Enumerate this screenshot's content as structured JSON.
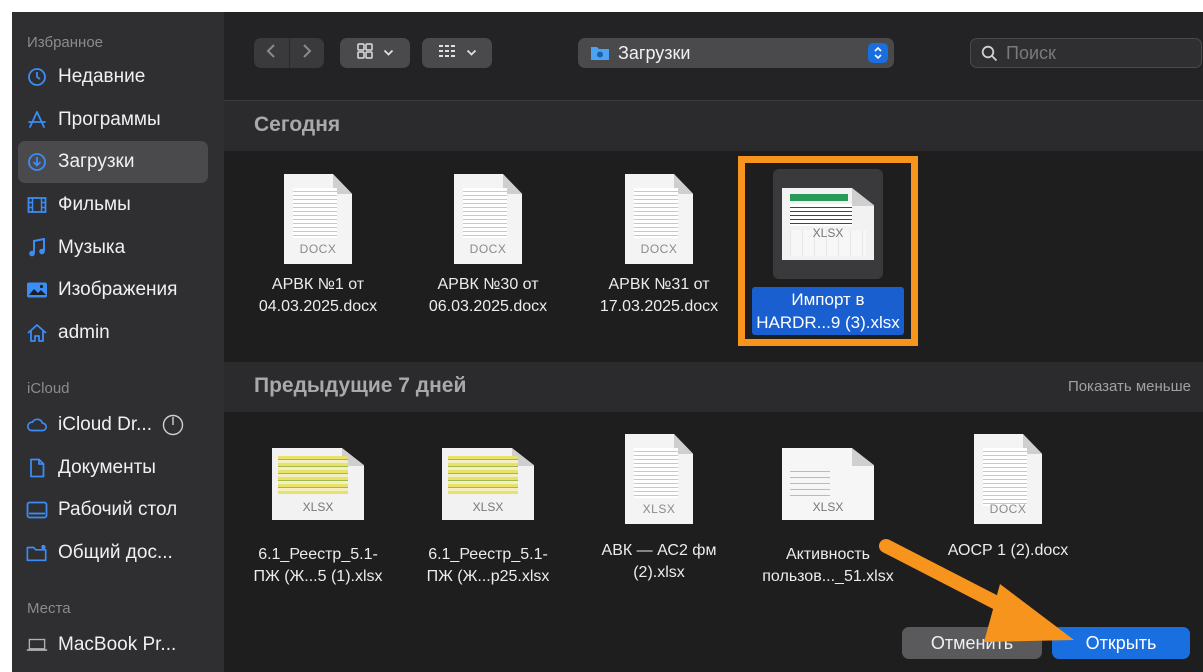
{
  "sidebar": {
    "favorites_title": "Избранное",
    "favorites": [
      {
        "label": "Недавние",
        "icon": "clock-icon"
      },
      {
        "label": "Программы",
        "icon": "apps-icon"
      },
      {
        "label": "Загрузки",
        "icon": "download-icon",
        "selected": true
      },
      {
        "label": "Фильмы",
        "icon": "film-icon"
      },
      {
        "label": "Музыка",
        "icon": "music-icon"
      },
      {
        "label": "Изображения",
        "icon": "photo-icon"
      },
      {
        "label": "admin",
        "icon": "home-icon"
      }
    ],
    "icloud_title": "iCloud",
    "icloud": [
      {
        "label": "iCloud Dr...",
        "icon": "cloud-icon"
      },
      {
        "label": "Документы",
        "icon": "document-icon"
      },
      {
        "label": "Рабочий стол",
        "icon": "desktop-icon"
      },
      {
        "label": "Общий дос...",
        "icon": "shared-folder-icon"
      }
    ],
    "places_title": "Места",
    "places": [
      {
        "label": "MacBook Pr...",
        "icon": "laptop-icon"
      }
    ]
  },
  "toolbar": {
    "location": "Загрузки",
    "search_placeholder": "Поиск"
  },
  "groups": [
    {
      "title": "Сегодня",
      "files": [
        {
          "name": "АРВК №1 от\n04.03.2025.docx",
          "ext": "DOCX",
          "kind": "docx"
        },
        {
          "name": "АРВК №30 от\n06.03.2025.docx",
          "ext": "DOCX",
          "kind": "docx"
        },
        {
          "name": "АРВК №31 от\n17.03.2025.docx",
          "ext": "DOCX",
          "kind": "docx"
        },
        {
          "name": "Импорт в\nHARDR...9 (3).xlsx",
          "ext": "XLSX",
          "kind": "xlsx",
          "selected": true
        }
      ]
    },
    {
      "title": "Предыдущие 7 дней",
      "action": "Показать меньше",
      "files": [
        {
          "name": "6.1_Реестр_5.1-\nПЖ (Ж...5 (1).xlsx",
          "ext": "XLSX",
          "kind": "xlsx"
        },
        {
          "name": "6.1_Реестр_5.1-\nПЖ (Ж...р25.xlsx",
          "ext": "XLSX",
          "kind": "xlsx"
        },
        {
          "name": "АВК — АС2 фм\n(2).xlsx",
          "ext": "XLSX",
          "kind": "xlsx"
        },
        {
          "name": "Активность\nпользов..._51.xlsx",
          "ext": "XLSX",
          "kind": "xlsx"
        },
        {
          "name": "АОСР  1 (2).docx",
          "ext": "DOCX",
          "kind": "docx"
        }
      ]
    }
  ],
  "footer": {
    "cancel": "Отменить",
    "open": "Открыть"
  },
  "colors": {
    "accent": "#1a6fe0",
    "highlight": "#f7941d",
    "window_bg": "#1e1e1e",
    "sidebar_bg": "#2f2f31"
  }
}
